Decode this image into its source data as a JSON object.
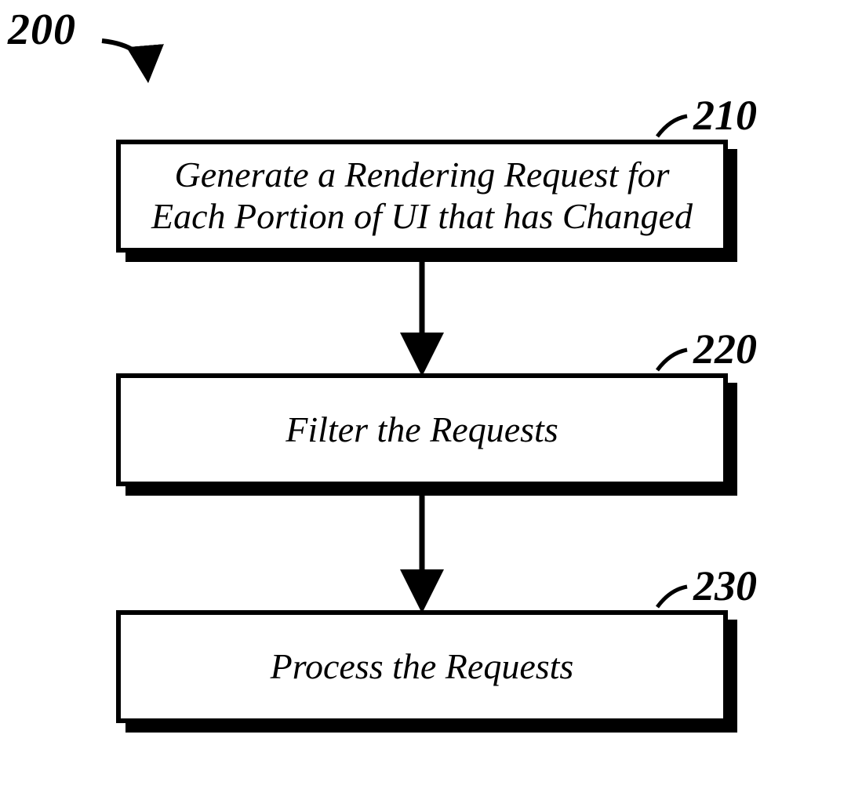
{
  "figure": {
    "label": "200"
  },
  "steps": [
    {
      "label": "210",
      "text": "Generate a Rendering Request for Each Portion of UI that has Changed"
    },
    {
      "label": "220",
      "text": "Filter the Requests"
    },
    {
      "label": "230",
      "text": "Process the Requests"
    }
  ]
}
